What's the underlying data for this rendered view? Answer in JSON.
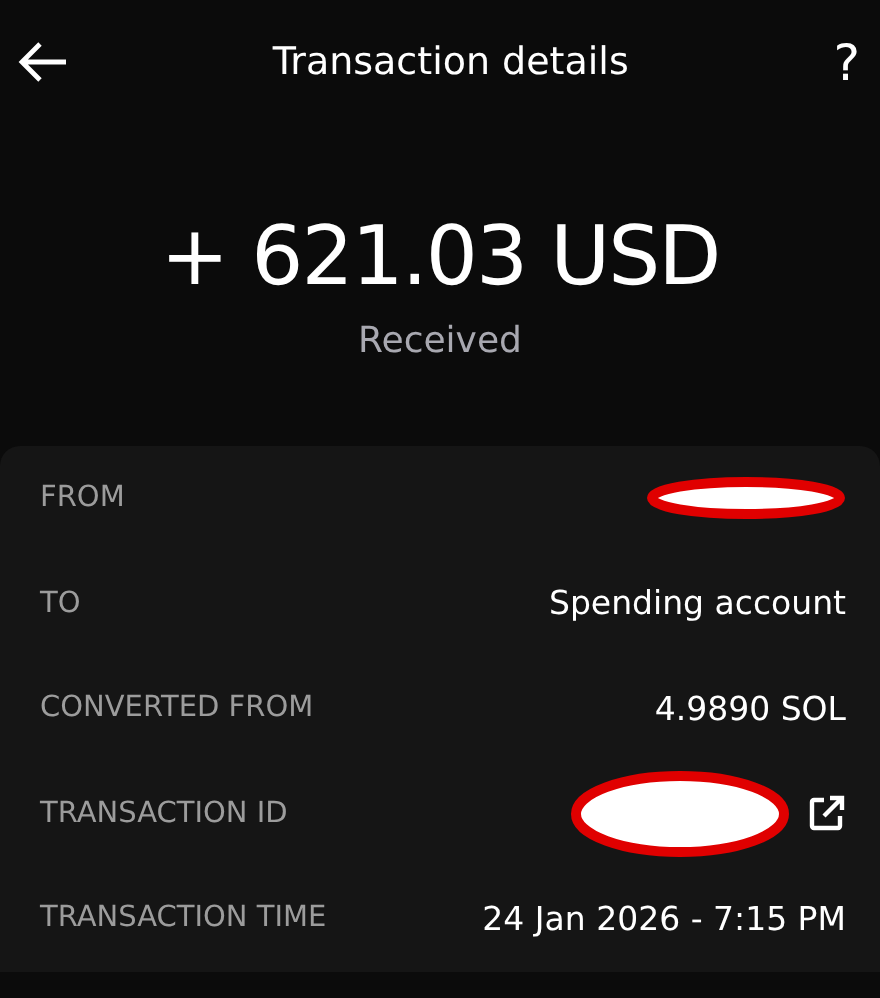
{
  "header": {
    "title": "Transaction details",
    "help": "?"
  },
  "amount": {
    "value": "+ 621.03 USD",
    "status": "Received"
  },
  "details": [
    {
      "label": "FROM",
      "kind": "redacted",
      "link": false
    },
    {
      "label": "TO",
      "kind": "text",
      "value": "Spending account"
    },
    {
      "label": "CONVERTED FROM",
      "kind": "text",
      "value": "4.9890 SOL"
    },
    {
      "label": "TRANSACTION ID",
      "kind": "redacted",
      "link": true
    },
    {
      "label": "TRANSACTION TIME",
      "kind": "text",
      "value": "24 Jan 2026 - 7:15 PM"
    }
  ]
}
